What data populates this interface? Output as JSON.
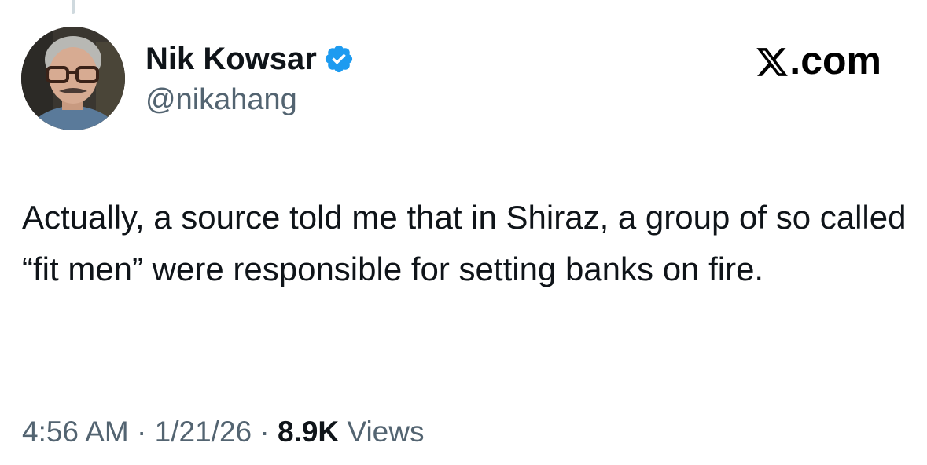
{
  "author": {
    "display_name": "Nik Kowsar",
    "handle": "@nikahang",
    "verified": true
  },
  "branding": {
    "site": ".com",
    "logo_icon": "x-logo-icon"
  },
  "tweet": {
    "text": "Actually, a source told me that in Shiraz, a group of so called “fit men” were responsible for setting banks on fire.",
    "time": "4:56 AM",
    "separator": "·",
    "date": "1/21/26",
    "views_count": "8.9K",
    "views_label": "Views"
  },
  "colors": {
    "verified_badge": "#1d9bf0",
    "secondary_text": "#536471",
    "primary_text": "#0f1419"
  }
}
